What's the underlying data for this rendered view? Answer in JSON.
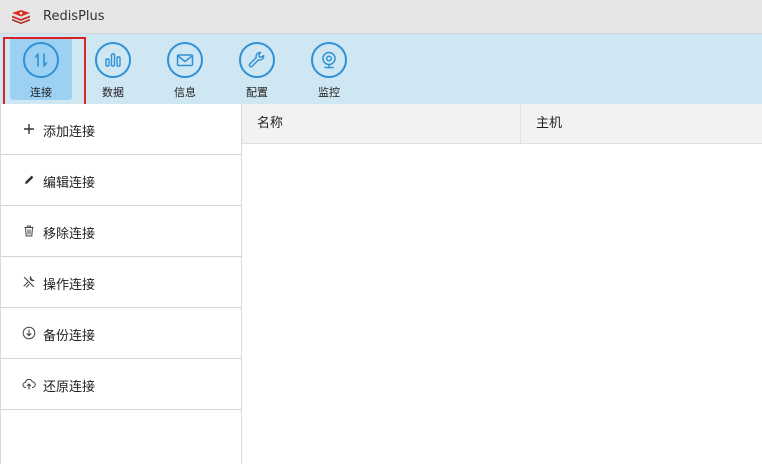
{
  "app": {
    "title": "RedisPlus",
    "logo_icon": "redis-logo-icon"
  },
  "toolbar": {
    "accent": "#2e91d5",
    "active_index": 0,
    "items": [
      {
        "label": "连接",
        "icon": "connection-arrows-icon"
      },
      {
        "label": "数据",
        "icon": "bar-chart-icon"
      },
      {
        "label": "信息",
        "icon": "envelope-icon"
      },
      {
        "label": "配置",
        "icon": "wrench-icon"
      },
      {
        "label": "监控",
        "icon": "webcam-icon"
      }
    ]
  },
  "sidebar": {
    "items": [
      {
        "label": "添加连接",
        "icon": "plus-icon"
      },
      {
        "label": "编辑连接",
        "icon": "pencil-icon"
      },
      {
        "label": "移除连接",
        "icon": "trash-icon"
      },
      {
        "label": "操作连接",
        "icon": "tools-icon"
      },
      {
        "label": "备份连接",
        "icon": "download-circle-icon"
      },
      {
        "label": "还原连接",
        "icon": "cloud-upload-icon"
      }
    ]
  },
  "table": {
    "columns": [
      "名称",
      "主机"
    ],
    "rows": []
  }
}
